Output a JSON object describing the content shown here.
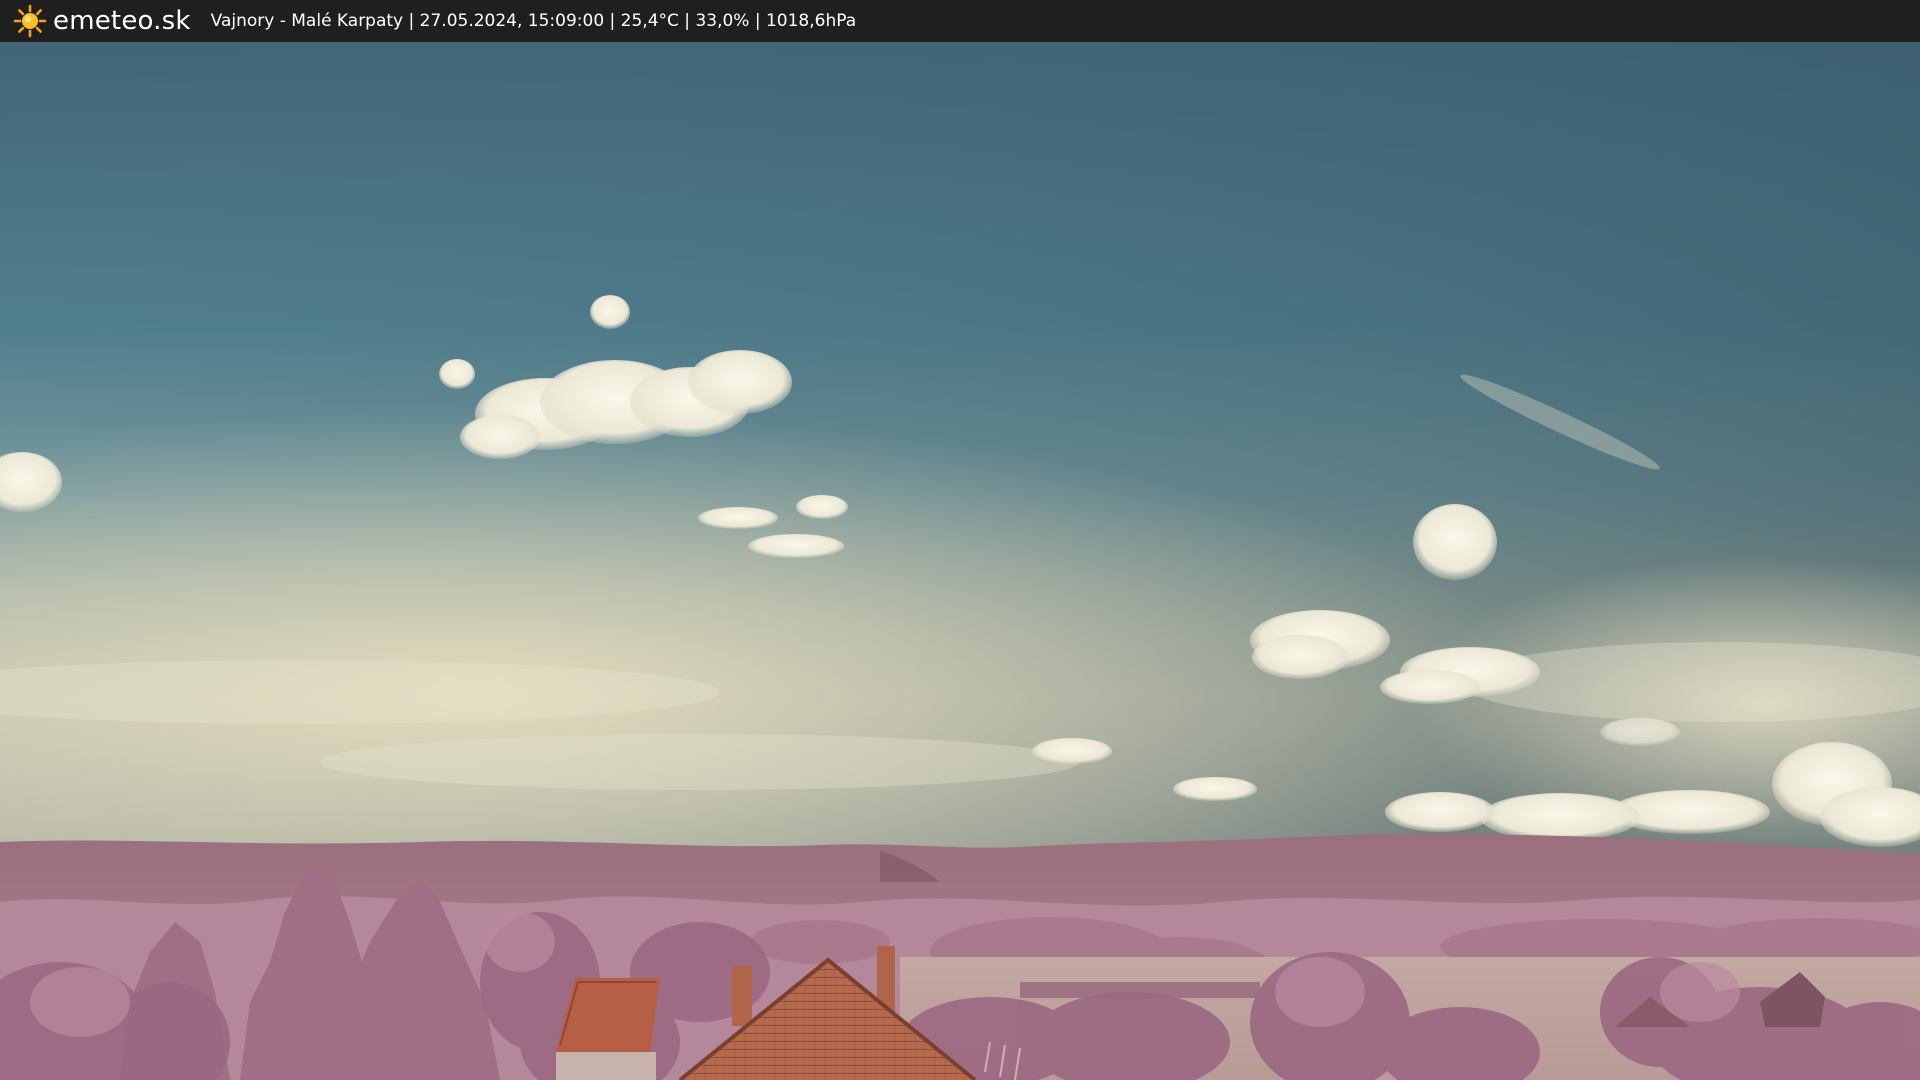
{
  "header": {
    "brand": "emeteo.sk",
    "caption": "Vajnory - Malé Karpaty | 27.05.2024, 15:09:00 | 25,4°C | 33,0% | 1018,6hPa",
    "logo_icon": "sun-icon"
  },
  "image": {
    "description_icon": "webcam-landscape-image",
    "colors": {
      "bar": "#1f1f1f",
      "sky_top": "#3f6273",
      "sky_mid": "#5e8a98",
      "sky_haze": "#d8d3b8",
      "hills": "#a47686",
      "foliage": "#b07f97",
      "field": "#c0a6a0",
      "roof": "#b8674a"
    }
  }
}
